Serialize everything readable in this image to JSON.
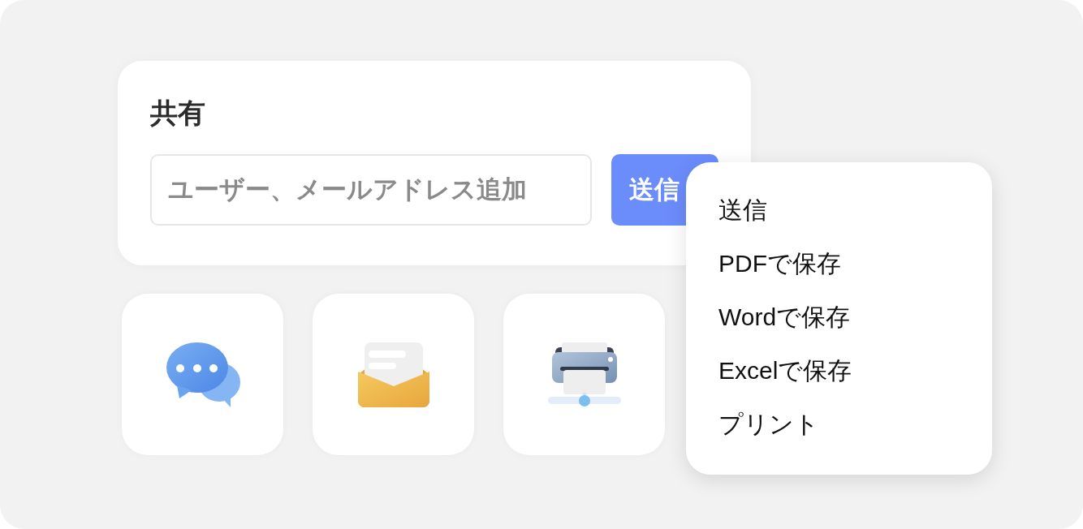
{
  "share_card": {
    "title": "共有",
    "recipient_field": {
      "placeholder": "ユーザー、メールアドレス追加"
    },
    "send_button": {
      "label": "送信"
    }
  },
  "share_options": [
    {
      "kind": "chat"
    },
    {
      "kind": "mail"
    },
    {
      "kind": "print"
    }
  ],
  "menu": {
    "items": [
      {
        "label": "送信"
      },
      {
        "label": "PDFで保存"
      },
      {
        "label": "Wordで保存"
      },
      {
        "label": "Excelで保存"
      },
      {
        "label": "プリント"
      }
    ]
  }
}
